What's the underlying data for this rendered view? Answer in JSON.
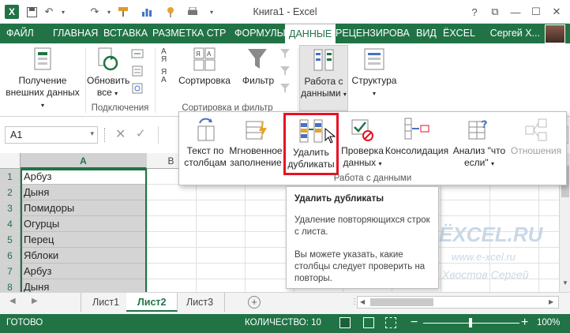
{
  "window": {
    "title": "Книга1 - Excel",
    "controls": [
      "?",
      "⧉",
      "—",
      "☐",
      "✕"
    ]
  },
  "quick_access": {
    "excel_icon": "excel-icon",
    "save": "save-icon",
    "undo": "undo-icon",
    "redo": "redo-icon",
    "paint": "format-painter-icon",
    "chart": "chart-icon",
    "pin": "pin-icon",
    "print": "print-icon",
    "customize": "dropdown-icon"
  },
  "tabs": [
    "ФАЙЛ",
    "ГЛАВНАЯ",
    "ВСТАВКА",
    "РАЗМЕТКА СТР",
    "ФОРМУЛЫ",
    "ДАННЫЕ",
    "РЕЦЕНЗИРОВА",
    "ВИД",
    "ЁXCEL"
  ],
  "active_tab": "ДАННЫЕ",
  "user": {
    "name": "Сергей Х..."
  },
  "ribbon": {
    "get_external_line1": "Получение",
    "get_external_line2": "внешних данных",
    "refresh_line1": "Обновить",
    "refresh_line2": "все",
    "group_connections": "Подключения",
    "sort_az": "А↓Я",
    "sort": "Сортировка",
    "filter": "Фильтр",
    "group_sort_filter": "Сортировка и фильтр",
    "data_tools_line1": "Работа с",
    "data_tools_line2": "данными",
    "structure": "Структура"
  },
  "panel": {
    "text_to_columns_1": "Текст по",
    "text_to_columns_2": "столбцам",
    "flash_fill_1": "Мгновенное",
    "flash_fill_2": "заполнение",
    "remove_duplicates_1": "Удалить",
    "remove_duplicates_2": "дубликаты",
    "validation_1": "Проверка",
    "validation_2": "данных",
    "consolidate": "Консолидация",
    "whatif_1": "Анализ \"что",
    "whatif_2": "если\"",
    "relationships": "Отношения",
    "group_label": "Работа с данными"
  },
  "tooltip": {
    "title": "Удалить дубликаты",
    "desc": "Удаление повторяющихся строк с листа.",
    "hint": "Вы можете указать, какие столбцы следует проверить на повторы."
  },
  "formula": {
    "namebox": "A1"
  },
  "grid": {
    "columns": [
      "A",
      "B"
    ],
    "rows": [
      {
        "n": "1",
        "value": "Арбуз"
      },
      {
        "n": "2",
        "value": "Дыня"
      },
      {
        "n": "3",
        "value": "Помидоры"
      },
      {
        "n": "4",
        "value": "Огурцы"
      },
      {
        "n": "5",
        "value": "Перец"
      },
      {
        "n": "6",
        "value": "Яблоки"
      },
      {
        "n": "7",
        "value": "Арбуз"
      },
      {
        "n": "8",
        "value": "Дыня"
      }
    ]
  },
  "watermark": {
    "logo": "ЁXCEL.RU",
    "url": "www.e-xcel.ru",
    "author": "Хвостов Сергей"
  },
  "sheets": [
    "Лист1",
    "Лист2",
    "Лист3"
  ],
  "active_sheet": "Лист2",
  "status": {
    "ready": "ГОТОВО",
    "count": "КОЛИЧЕСТВО: 10",
    "zoom": "100%"
  },
  "colors": {
    "accent": "#217346",
    "highlight_border": "#e81123",
    "selection": "#d4d4d4"
  }
}
